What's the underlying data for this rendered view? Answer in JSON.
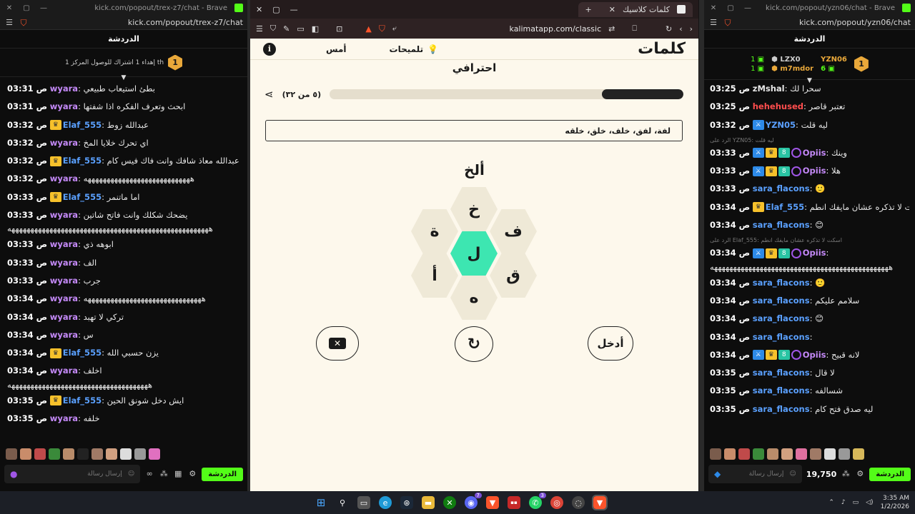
{
  "left_window": {
    "title": "kick.com/popout/trex-z7/chat - Brave",
    "url": "kick.com/popout/trex-z7/chat",
    "chat_header": "الدردشة",
    "pinned_level": "1",
    "pinned_text": "إهداء 1 اشتراك للوصول المركز 1 th",
    "messages": [
      {
        "time": "03:31 ص",
        "user": "wyara",
        "color": "#c58af9",
        "badge": "",
        "text": "بطئ استيعاب طبيعي"
      },
      {
        "time": "03:31 ص",
        "user": "wyara",
        "color": "#c58af9",
        "badge": "",
        "text": "ابحث وتعرف الفكره اذا شفتها"
      },
      {
        "time": "03:32 ص",
        "user": "Elaf_555",
        "color": "#5aa0ff",
        "badge": "crown",
        "text": "عبدالله زوط"
      },
      {
        "time": "03:32 ص",
        "user": "wyara",
        "color": "#c58af9",
        "badge": "",
        "text": "اي تحرك خلايا المخ"
      },
      {
        "time": "03:32 ص",
        "user": "Elaf_555",
        "color": "#5aa0ff",
        "badge": "crown",
        "text": "عبدالله معاذ شافك وانت فاك فيس كام"
      },
      {
        "time": "03:32 ص",
        "user": "wyara",
        "color": "#c58af9",
        "badge": "",
        "text": "ههههههههههههههههههههههههههههه"
      },
      {
        "time": "03:33 ص",
        "user": "Elaf_555",
        "color": "#5aa0ff",
        "badge": "crown",
        "text": "اما ماتنمر"
      },
      {
        "time": "03:33 ص",
        "user": "wyara",
        "color": "#c58af9",
        "badge": "",
        "text": "يضحك شكلك وانت فاتح شاتين",
        "wrap": "هههههههههههههههههههههههههههههههههههههههههههههههههههههه"
      },
      {
        "time": "03:33 ص",
        "user": "wyara",
        "color": "#c58af9",
        "badge": "",
        "text": "ابوهه ذي"
      },
      {
        "time": "03:33 ص",
        "user": "wyara",
        "color": "#c58af9",
        "badge": "",
        "text": "الف"
      },
      {
        "time": "03:33 ص",
        "user": "wyara",
        "color": "#c58af9",
        "badge": "",
        "text": "جرب"
      },
      {
        "time": "03:34 ص",
        "user": "wyara",
        "color": "#c58af9",
        "badge": "",
        "text": "هههههههههههههههههههههههههههههههه"
      },
      {
        "time": "03:34 ص",
        "user": "wyara",
        "color": "#c58af9",
        "badge": "",
        "text": "تركي لا تهبد"
      },
      {
        "time": "03:34 ص",
        "user": "wyara",
        "color": "#c58af9",
        "badge": "",
        "text": "س"
      },
      {
        "time": "03:34 ص",
        "user": "Elaf_555",
        "color": "#5aa0ff",
        "badge": "crown",
        "text": "يزن حسبي الله"
      },
      {
        "time": "03:34 ص",
        "user": "wyara",
        "color": "#c58af9",
        "badge": "",
        "text": "اخلف",
        "wrap": "هههههههههههههههههههههههههههههههههههههه"
      },
      {
        "time": "03:35 ص",
        "user": "Elaf_555",
        "color": "#5aa0ff",
        "badge": "crown",
        "text": "ايش دخل شونق الحين"
      },
      {
        "time": "03:35 ص",
        "user": "wyara",
        "color": "#c58af9",
        "badge": "",
        "text": "خلفه"
      }
    ],
    "input_placeholder": "إرسال رسالة",
    "send_label": "الدردشة"
  },
  "mid_window": {
    "tab_title": "كلمات كلاسيك",
    "url": "kalimatapp.com/classic",
    "logo": "كلمات",
    "hints_label": "تلميحات",
    "yesterday_label": "أمس",
    "level": "احترافي",
    "progress_label": "(٥ من ٣٢)",
    "progress_fraction": 0.23,
    "found_words": "لفة، لفق، خلف، خلق، خلقه",
    "current_word": "ألخ",
    "letters": {
      "top": "خ",
      "upper_left": "ة",
      "upper_right": "ف",
      "center": "ل",
      "lower_left": "أ",
      "lower_right": "ق",
      "bottom": "ه"
    },
    "enter_label": "أدخل",
    "center_color": "#3de6b1"
  },
  "right_window": {
    "title": "kick.com/popout/yzn06/chat - Brave",
    "url": "kick.com/popout/yzn06/chat",
    "chat_header": "الدردشة",
    "leaders": [
      {
        "rank": "1",
        "name": "YZN06",
        "count": "6"
      },
      {
        "rank": "1",
        "name": "LZX0",
        "count": ""
      },
      {
        "rank": "",
        "name": "m7mdor",
        "count": "1"
      }
    ],
    "messages": [
      {
        "time": "03:25 ص",
        "user": "zMshal",
        "color": "#e8e8e8",
        "text": "سحرا لك"
      },
      {
        "time": "03:25 ص",
        "user": "hehehused",
        "color": "#ff4d4d",
        "text": "تعتبر قاصر"
      },
      {
        "time": "03:32 ص",
        "user": "YZN05",
        "color": "#5aa0ff",
        "text": "ليه قلت"
      },
      {
        "time": "03:33 ص",
        "user": "Opiis",
        "color": "#c58af9",
        "text": "وينك",
        "reply": "الرد على YZN05: ليه قلت"
      },
      {
        "time": "03:33 ص",
        "user": "Opiis",
        "color": "#c58af9",
        "text": "هلا"
      },
      {
        "time": "03:33 ص",
        "user": "sara_flacons",
        "color": "#5aa0ff",
        "text": "🙂"
      },
      {
        "time": "03:34 ص",
        "user": "Elaf_555",
        "color": "#5aa0ff",
        "text": "اسكت لا تذكره عشان مايفك انطم"
      },
      {
        "time": "03:34 ص",
        "user": "sara_flacons",
        "color": "#5aa0ff",
        "text": "😊"
      },
      {
        "time": "03:34 ص",
        "user": "Opiis",
        "color": "#c58af9",
        "text": "",
        "reply": "الرد على Elaf_555: اسكت لا تذكره عشان مايفك انطم",
        "wrap": "هههههههههههههههههههههههههههههههههههههههههههههههه"
      },
      {
        "time": "03:34 ص",
        "user": "sara_flacons",
        "color": "#5aa0ff",
        "text": "🙂"
      },
      {
        "time": "03:34 ص",
        "user": "sara_flacons",
        "color": "#5aa0ff",
        "text": "سلامم عليكم"
      },
      {
        "time": "03:34 ص",
        "user": "sara_flacons",
        "color": "#5aa0ff",
        "text": "😊"
      },
      {
        "time": "03:34 ص",
        "user": "sara_flacons",
        "color": "#5aa0ff",
        "text": ""
      },
      {
        "time": "03:34 ص",
        "user": "Opiis",
        "color": "#c58af9",
        "text": "لانه قبيح"
      },
      {
        "time": "03:35 ص",
        "user": "sara_flacons",
        "color": "#5aa0ff",
        "text": "لا قال"
      },
      {
        "time": "03:35 ص",
        "user": "sara_flacons",
        "color": "#5aa0ff",
        "text": "شسالفه"
      },
      {
        "time": "03:35 ص",
        "user": "sara_flacons",
        "color": "#5aa0ff",
        "text": "ليه صدق فتح كام"
      }
    ],
    "input_placeholder": "إرسال رسالة",
    "points": "19,750",
    "send_label": "الدردشة"
  },
  "taskbar": {
    "time": "3:35 AM",
    "date": "1/2/2026",
    "discord_badge": "7",
    "whatsapp_badge": "3"
  }
}
